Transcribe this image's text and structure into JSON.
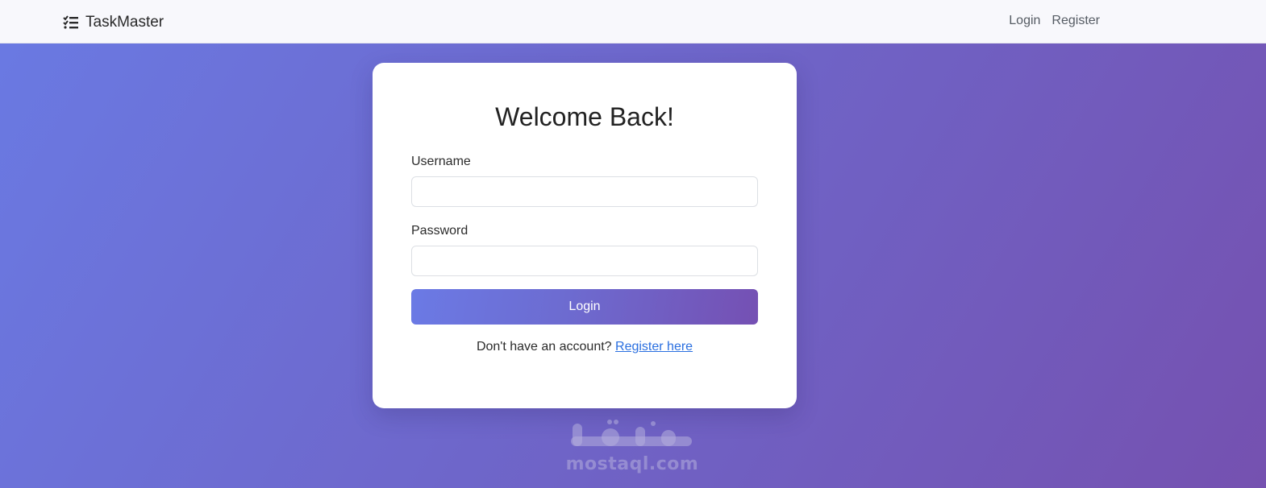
{
  "navbar": {
    "brand": "TaskMaster",
    "brand_icon": "list-check-icon",
    "links": [
      "Login",
      "Register"
    ]
  },
  "form": {
    "title": "Welcome Back!",
    "username_label": "Username",
    "username_value": "",
    "password_label": "Password",
    "password_value": "",
    "login_button": "Login",
    "register_prompt": "Don't have an account?",
    "register_link": "Register here"
  },
  "watermark": {
    "logo": "مستقل",
    "text": "mostaql.com"
  },
  "colors": {
    "background_start": "#6a7ae3",
    "background_end": "#7551b0",
    "link": "#2a6fe0"
  }
}
